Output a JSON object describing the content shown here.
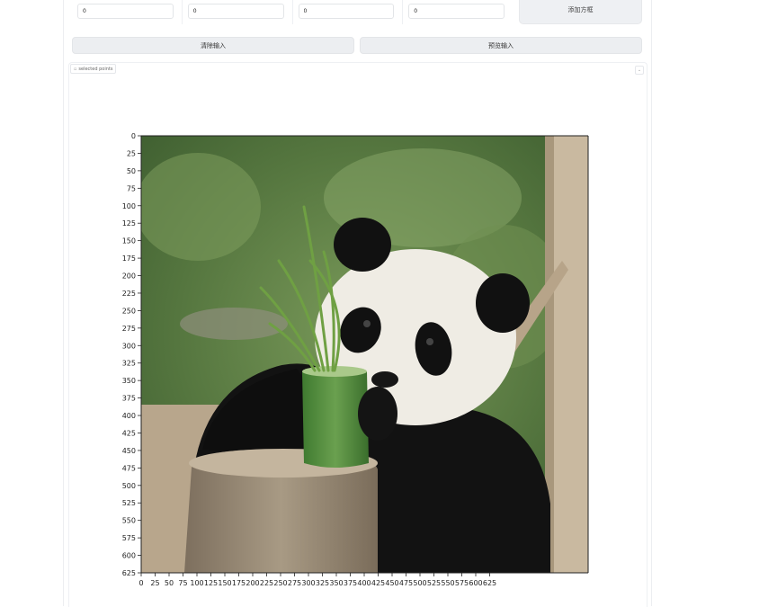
{
  "coord_inputs": [
    {
      "value": "0"
    },
    {
      "value": "0"
    },
    {
      "value": "0"
    },
    {
      "value": "0"
    }
  ],
  "buttons": {
    "add_box": "添加方框",
    "clear_input": "清除输入",
    "preview_input": "预览输入"
  },
  "panel": {
    "label": "selected points"
  },
  "image_plot": {
    "y_ticks": [
      "0",
      "25",
      "50",
      "75",
      "100",
      "125",
      "150",
      "175",
      "200",
      "225",
      "250",
      "275",
      "300",
      "325",
      "350",
      "375",
      "400",
      "425",
      "450",
      "475",
      "500",
      "525",
      "550",
      "575",
      "600",
      "625"
    ],
    "x_ticks": [
      "0",
      "25",
      "50",
      "75",
      "100",
      "125",
      "150",
      "175",
      "200",
      "225",
      "250",
      "275",
      "300",
      "325",
      "350",
      "375",
      "400",
      "425",
      "450",
      "475",
      "500",
      "525",
      "550",
      "575",
      "600",
      "625"
    ],
    "colors": {
      "bg_green": "#5b7d46",
      "panda_white": "#f0ede6",
      "panda_black": "#111111",
      "stump": "#9a8b76",
      "bamboo_cup": "#4f8a3c"
    }
  }
}
